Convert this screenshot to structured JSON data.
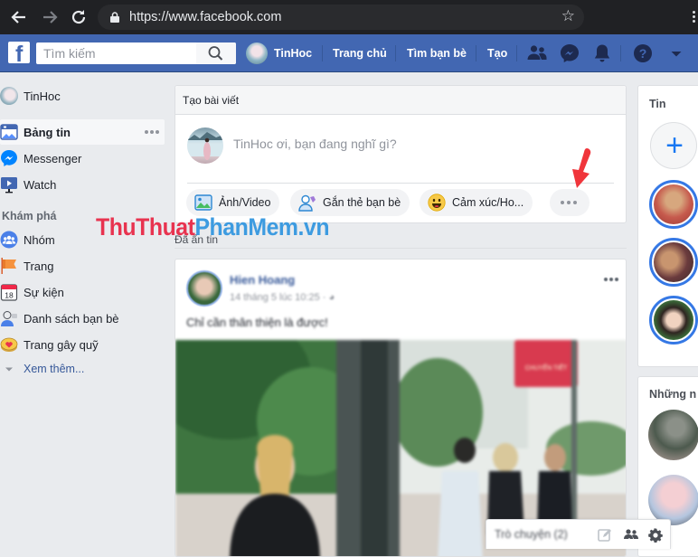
{
  "browser": {
    "url": "https://www.facebook.com",
    "back_icon": "arrow-left-icon",
    "forward_icon": "arrow-right-icon",
    "reload_icon": "reload-icon",
    "lock_icon": "lock-icon",
    "bookmark_icon": "star-icon",
    "menu_icon": "kebab-menu-icon"
  },
  "topbar": {
    "logo": "f",
    "search_placeholder": "Tìm kiếm",
    "profile_name": "TinHoc",
    "nav": [
      "Trang chủ",
      "Tìm bạn bè",
      "Tạo"
    ],
    "icons": [
      "friends-icon",
      "messenger-icon",
      "bell-icon",
      "help-icon",
      "caret-down-icon"
    ],
    "bar_color": "#4267b2"
  },
  "left_nav": {
    "profile": "TinHoc",
    "items": [
      {
        "label": "Bảng tin",
        "icon": "news-feed-icon",
        "active": true
      },
      {
        "label": "Messenger",
        "icon": "messenger-icon"
      },
      {
        "label": "Watch",
        "icon": "watch-icon"
      }
    ],
    "explore_heading": "Khám phá",
    "explore_items": [
      {
        "label": "Nhóm",
        "icon": "groups-icon"
      },
      {
        "label": "Trang",
        "icon": "flag-icon"
      },
      {
        "label": "Sự kiện",
        "icon": "calendar-icon",
        "icon_text": "18"
      },
      {
        "label": "Danh sách bạn bè",
        "icon": "friend-list-icon"
      },
      {
        "label": "Trang gây quỹ",
        "icon": "fundraiser-icon"
      }
    ],
    "see_more": "Xem thêm..."
  },
  "composer": {
    "title": "Tạo bài viết",
    "placeholder": "TinHoc ơi, bạn đang nghĩ gì?",
    "actions": [
      {
        "label": "Ảnh/Video",
        "icon": "photo-icon"
      },
      {
        "label": "Gắn thẻ bạn bè",
        "icon": "tag-friends-icon"
      },
      {
        "label": "Cảm xúc/Ho...",
        "icon": "emoji-icon"
      }
    ],
    "more_icon": "more-dots-icon",
    "annotation": "red-arrow-pointer"
  },
  "watermark": {
    "part1": "ThuThuat",
    "part2": "PhanMem.vn"
  },
  "feed": {
    "section_label": "Đã ẩn tin",
    "post": {
      "author": "Hien Hoang",
      "timestamp": "14 tháng 5 lúc 10:25 ·",
      "privacy_icon": "globe-icon",
      "text": "Chỉ cần thân thiện là được!",
      "image_sign_text": "CHUYẾN TIẾT"
    }
  },
  "right_col": {
    "stories_title": "Tin",
    "add_story_icon": "plus-icon",
    "people_title": "Những n"
  },
  "chat": {
    "label": "Trò chuyện (2)",
    "icons": [
      "compose-icon",
      "new-group-icon",
      "settings-gear-icon"
    ]
  }
}
